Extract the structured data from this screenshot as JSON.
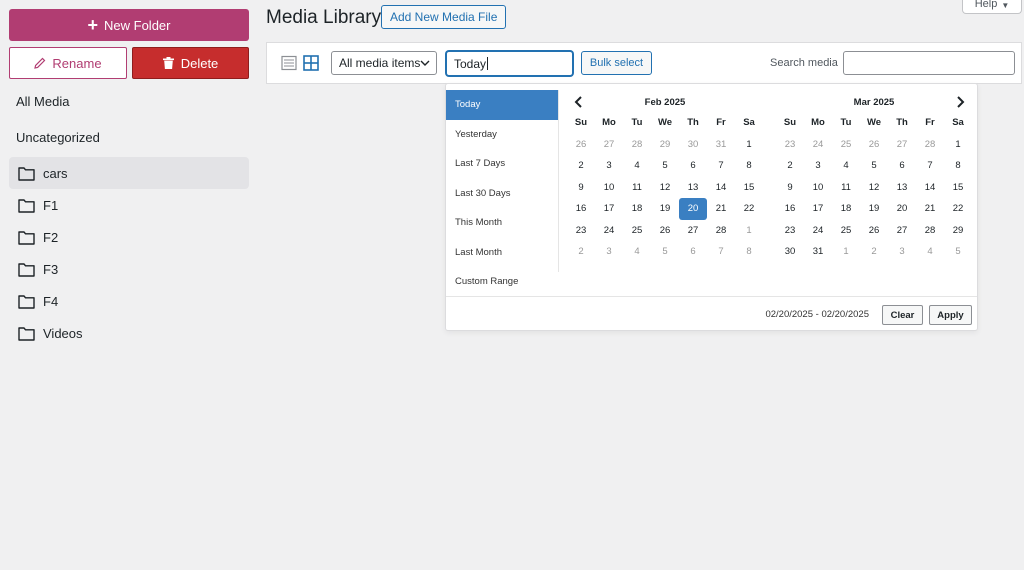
{
  "sidebar": {
    "new_folder_label": "New Folder",
    "rename_label": "Rename",
    "delete_label": "Delete",
    "all_media_label": "All Media",
    "uncategorized_label": "Uncategorized",
    "folders": [
      "cars",
      "F1",
      "F2",
      "F3",
      "F4",
      "Videos"
    ]
  },
  "header": {
    "title": "Media Library",
    "add_new_label": "Add New Media File",
    "help_label": "Help"
  },
  "toolbar": {
    "media_filter_value": "All media items",
    "date_value": "Today",
    "bulk_select_label": "Bulk select",
    "search_label": "Search media",
    "search_value": ""
  },
  "datepicker": {
    "ranges": [
      "Today",
      "Yesterday",
      "Last 7 Days",
      "Last 30 Days",
      "This Month",
      "Last Month",
      "Custom Range"
    ],
    "active_range": "Today",
    "weekdays": [
      "Su",
      "Mo",
      "Tu",
      "We",
      "Th",
      "Fr",
      "Sa"
    ],
    "left_month": {
      "title": "Feb 2025",
      "days": [
        {
          "d": "26",
          "off": true
        },
        {
          "d": "27",
          "off": true
        },
        {
          "d": "28",
          "off": true
        },
        {
          "d": "29",
          "off": true
        },
        {
          "d": "30",
          "off": true
        },
        {
          "d": "31",
          "off": true
        },
        {
          "d": "1"
        },
        {
          "d": "2"
        },
        {
          "d": "3"
        },
        {
          "d": "4"
        },
        {
          "d": "5"
        },
        {
          "d": "6"
        },
        {
          "d": "7"
        },
        {
          "d": "8"
        },
        {
          "d": "9"
        },
        {
          "d": "10"
        },
        {
          "d": "11"
        },
        {
          "d": "12"
        },
        {
          "d": "13"
        },
        {
          "d": "14"
        },
        {
          "d": "15"
        },
        {
          "d": "16"
        },
        {
          "d": "17"
        },
        {
          "d": "18"
        },
        {
          "d": "19"
        },
        {
          "d": "20",
          "sel": true
        },
        {
          "d": "21"
        },
        {
          "d": "22"
        },
        {
          "d": "23"
        },
        {
          "d": "24"
        },
        {
          "d": "25"
        },
        {
          "d": "26"
        },
        {
          "d": "27"
        },
        {
          "d": "28"
        },
        {
          "d": "1",
          "off": true
        },
        {
          "d": "2",
          "off": true
        },
        {
          "d": "3",
          "off": true
        },
        {
          "d": "4",
          "off": true
        },
        {
          "d": "5",
          "off": true
        },
        {
          "d": "6",
          "off": true
        },
        {
          "d": "7",
          "off": true
        },
        {
          "d": "8",
          "off": true
        }
      ]
    },
    "right_month": {
      "title": "Mar 2025",
      "days": [
        {
          "d": "23",
          "off": true
        },
        {
          "d": "24",
          "off": true
        },
        {
          "d": "25",
          "off": true
        },
        {
          "d": "26",
          "off": true
        },
        {
          "d": "27",
          "off": true
        },
        {
          "d": "28",
          "off": true
        },
        {
          "d": "1"
        },
        {
          "d": "2"
        },
        {
          "d": "3"
        },
        {
          "d": "4"
        },
        {
          "d": "5"
        },
        {
          "d": "6"
        },
        {
          "d": "7"
        },
        {
          "d": "8"
        },
        {
          "d": "9"
        },
        {
          "d": "10"
        },
        {
          "d": "11"
        },
        {
          "d": "12"
        },
        {
          "d": "13"
        },
        {
          "d": "14"
        },
        {
          "d": "15"
        },
        {
          "d": "16"
        },
        {
          "d": "17"
        },
        {
          "d": "18"
        },
        {
          "d": "19"
        },
        {
          "d": "20"
        },
        {
          "d": "21"
        },
        {
          "d": "22"
        },
        {
          "d": "23"
        },
        {
          "d": "24"
        },
        {
          "d": "25"
        },
        {
          "d": "26"
        },
        {
          "d": "27"
        },
        {
          "d": "28"
        },
        {
          "d": "29"
        },
        {
          "d": "30"
        },
        {
          "d": "31"
        },
        {
          "d": "1",
          "off": true
        },
        {
          "d": "2",
          "off": true
        },
        {
          "d": "3",
          "off": true
        },
        {
          "d": "4",
          "off": true
        },
        {
          "d": "5",
          "off": true
        }
      ]
    },
    "selected_range_text": "02/20/2025 - 02/20/2025",
    "clear_label": "Clear",
    "apply_label": "Apply"
  },
  "colors": {
    "accent": "#b13d72",
    "danger": "#c62d2d",
    "primary": "#2271b1",
    "picker_active": "#3a7fc2"
  },
  "icons": {
    "new_folder": "plus-icon",
    "rename": "pencil-icon",
    "delete": "trash-icon",
    "folder": "folder-icon",
    "list_view": "list-view-icon",
    "grid_view": "grid-view-icon",
    "prev": "chevron-left-icon",
    "next": "chevron-right-icon"
  }
}
